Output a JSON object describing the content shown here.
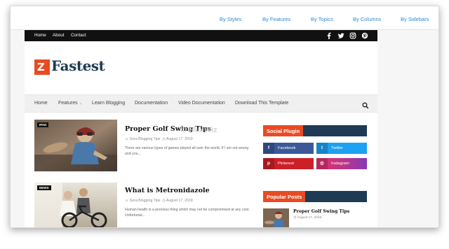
{
  "top_links": [
    "By Styles",
    "By Features",
    "By Topics",
    "By Columns",
    "By Sidebars"
  ],
  "top_menu": [
    "Home",
    "About",
    "Contact"
  ],
  "social_icons": [
    "facebook-icon",
    "twitter-icon",
    "instagram-icon",
    "pinterest-icon"
  ],
  "logo": {
    "text": "Fastest"
  },
  "main_nav": [
    "Home",
    "Features",
    "Learn Blogging",
    "Documentation",
    "Video Documentation",
    "Download This Template"
  ],
  "features_caret": "⌄",
  "watermark": "© FluxWiz",
  "posts": [
    {
      "tag": "IPAD",
      "title": "Proper Golf Swing Tips",
      "author": "Sora Blogging Tips",
      "date": "August 17, 2019",
      "excerpt": "There are various types of games played all over the world. If I am not wrong and you..."
    },
    {
      "tag": "NEWS",
      "title": "What is Metronidazole",
      "author": "Sora Blogging Tips",
      "date": "August 17, 2019",
      "excerpt": "Human health is a precious thing which may not be compromised at any cost. Unfortunat..."
    }
  ],
  "sidebar": {
    "social_plugin_title": "Social Plugin",
    "buttons": [
      {
        "label": "Facebook",
        "icon": "f",
        "color": "#3b5998"
      },
      {
        "label": "Twitter",
        "icon": "t",
        "color": "#1da1f2"
      },
      {
        "label": "Pinterest",
        "icon": "p",
        "color": "#cb2027"
      },
      {
        "label": "Instagram",
        "icon": "◎",
        "color": "#c13584"
      }
    ],
    "popular_posts_title": "Popular Posts",
    "popular": {
      "title": "Proper Golf Swing Tips",
      "date": "August 17, 2019"
    }
  },
  "colors": {
    "accent": "#e84b23",
    "navy": "#1f3a54",
    "link_blue": "#2b8ad8"
  }
}
